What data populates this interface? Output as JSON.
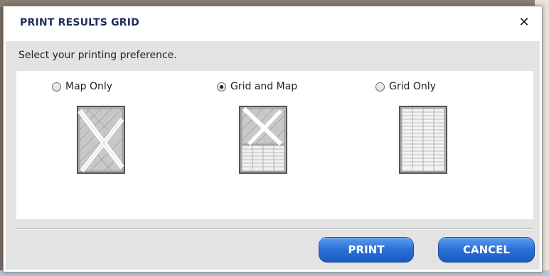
{
  "dialog": {
    "title": "PRINT RESULTS GRID",
    "close_icon": "close-icon",
    "close_glyph": "✕",
    "prompt": "Select your printing preference.",
    "options": [
      {
        "label": "Map Only",
        "checked": false,
        "icon": "map-only-thumbnail-icon"
      },
      {
        "label": "Grid and Map",
        "checked": true,
        "icon": "grid-and-map-thumbnail-icon"
      },
      {
        "label": "Grid Only",
        "checked": false,
        "icon": "grid-only-thumbnail-icon"
      }
    ],
    "buttons": {
      "print": "PRINT",
      "cancel": "CANCEL"
    }
  },
  "colors": {
    "title": "#1e2d5a",
    "button_top": "#5a9df0",
    "button_bottom": "#1a5bc0",
    "body_bg": "#e3e3e3"
  }
}
